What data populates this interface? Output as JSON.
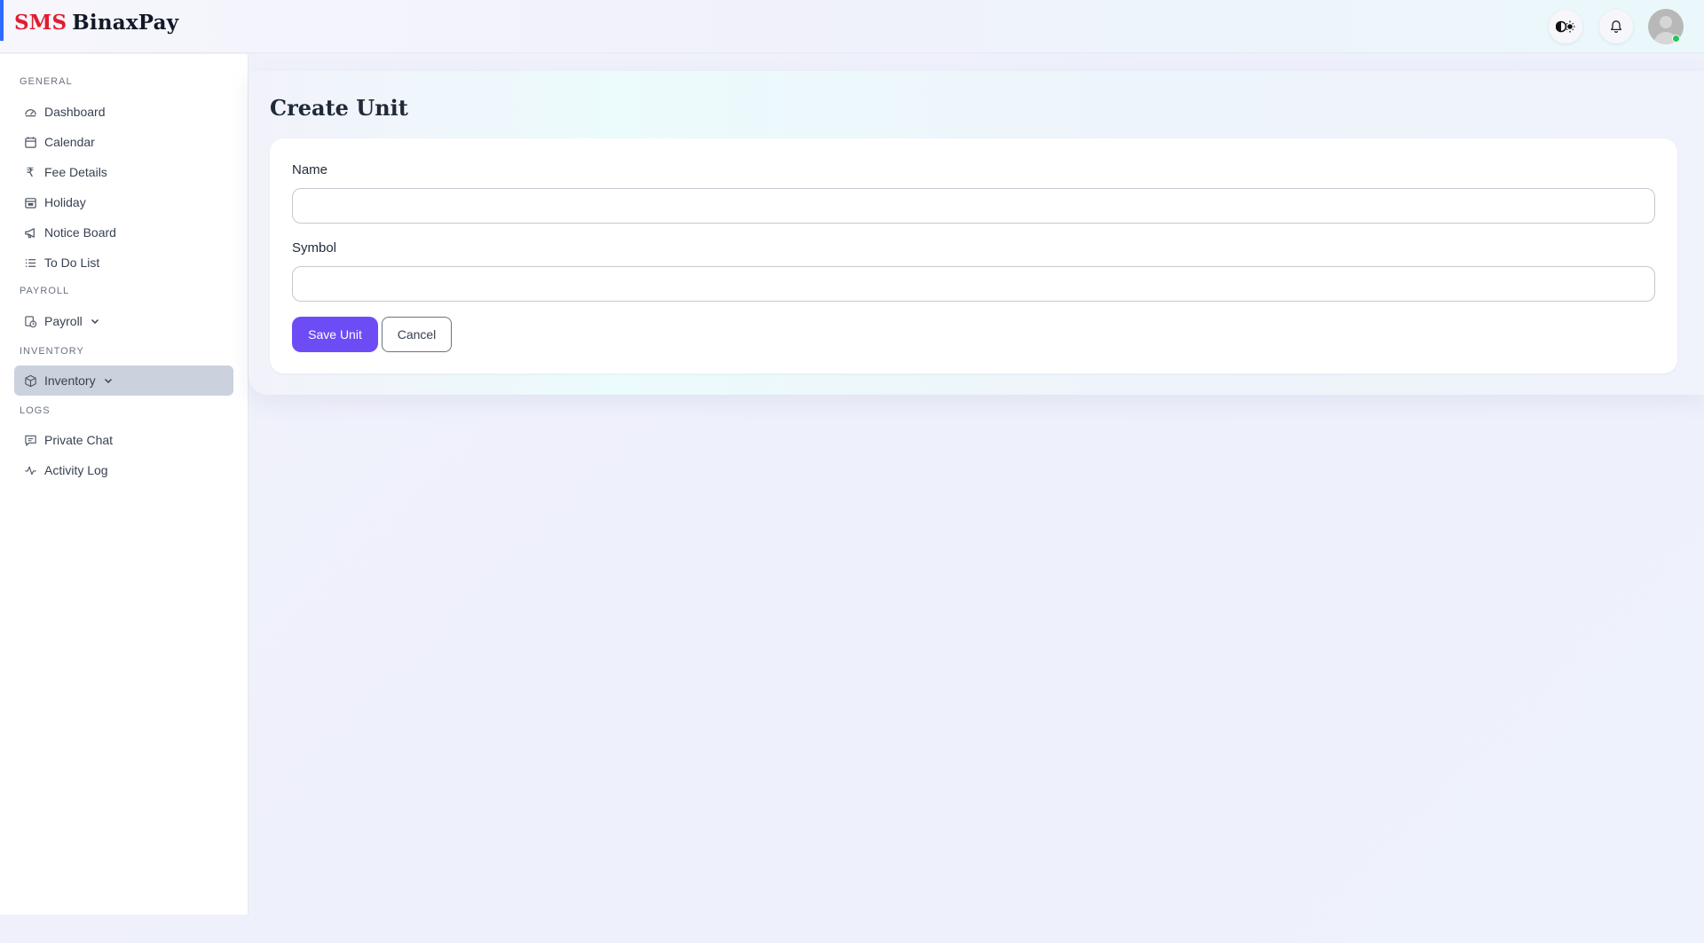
{
  "brand": {
    "part1": "SMS",
    "part2": "BinaxPay"
  },
  "header": {
    "icons": [
      "theme-toggle-icon",
      "bell-icon",
      "user-avatar"
    ]
  },
  "sidebar": {
    "sections": {
      "general": "GENERAL",
      "payroll": "PAYROLL",
      "inventory": "INVENTORY",
      "logs": "LOGS"
    },
    "items": {
      "dashboard": "Dashboard",
      "calendar": "Calendar",
      "fee_details": "Fee Details",
      "holiday": "Holiday",
      "notice_board": "Notice Board",
      "todo": "To Do List",
      "payroll": "Payroll",
      "inventory": "Inventory",
      "private_chat": "Private Chat",
      "activity_log": "Activity Log"
    },
    "active": "Inventory"
  },
  "main": {
    "title": "Create Unit",
    "form": {
      "name_label": "Name",
      "name_value": "",
      "symbol_label": "Symbol",
      "symbol_value": "",
      "save_label": "Save Unit",
      "cancel_label": "Cancel"
    }
  },
  "colors": {
    "accent": "#6d4cf6",
    "brand_red": "#e11d2e",
    "active_nav": "#cbd2dd",
    "online": "#22c55e"
  }
}
